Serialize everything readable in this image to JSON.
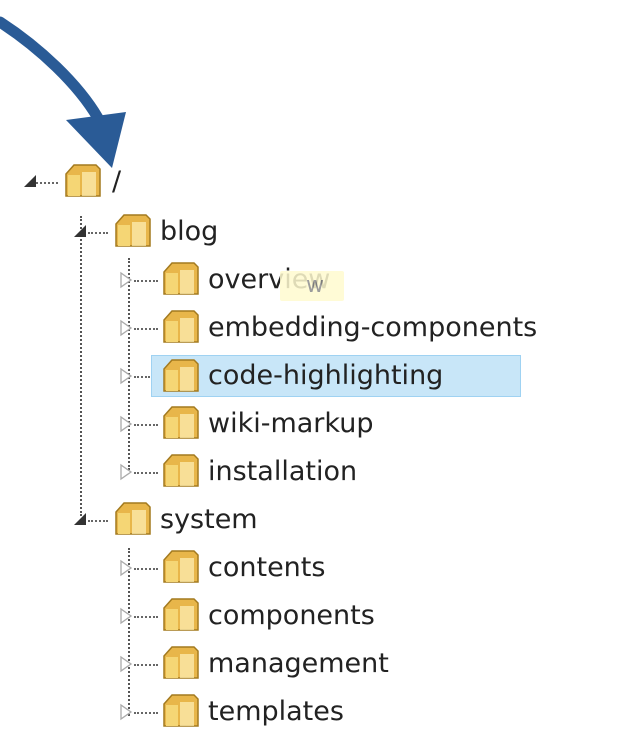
{
  "tree": {
    "root": {
      "label": "/"
    },
    "nodes": [
      {
        "label": "blog",
        "expanded": true
      },
      {
        "label": "overview",
        "expanded": false
      },
      {
        "label": "embedding-components",
        "expanded": false
      },
      {
        "label": "code-highlighting",
        "expanded": false,
        "selected": true
      },
      {
        "label": "wiki-markup",
        "expanded": false
      },
      {
        "label": "installation",
        "expanded": false
      },
      {
        "label": "system",
        "expanded": true
      },
      {
        "label": "contents",
        "expanded": false
      },
      {
        "label": "components",
        "expanded": false
      },
      {
        "label": "management",
        "expanded": false
      },
      {
        "label": "templates",
        "expanded": false
      }
    ]
  },
  "tooltip": {
    "text": "w"
  },
  "colors": {
    "selection": "#c8e6f8",
    "arrow": "#2a5b96",
    "folder": "#e8b64a",
    "tooltip": "#fffbd0"
  },
  "icons": {
    "expanded": "triangle-expanded-icon",
    "collapsed": "triangle-collapsed-icon",
    "folder": "folder-icon",
    "annotation": "callout-arrow"
  }
}
